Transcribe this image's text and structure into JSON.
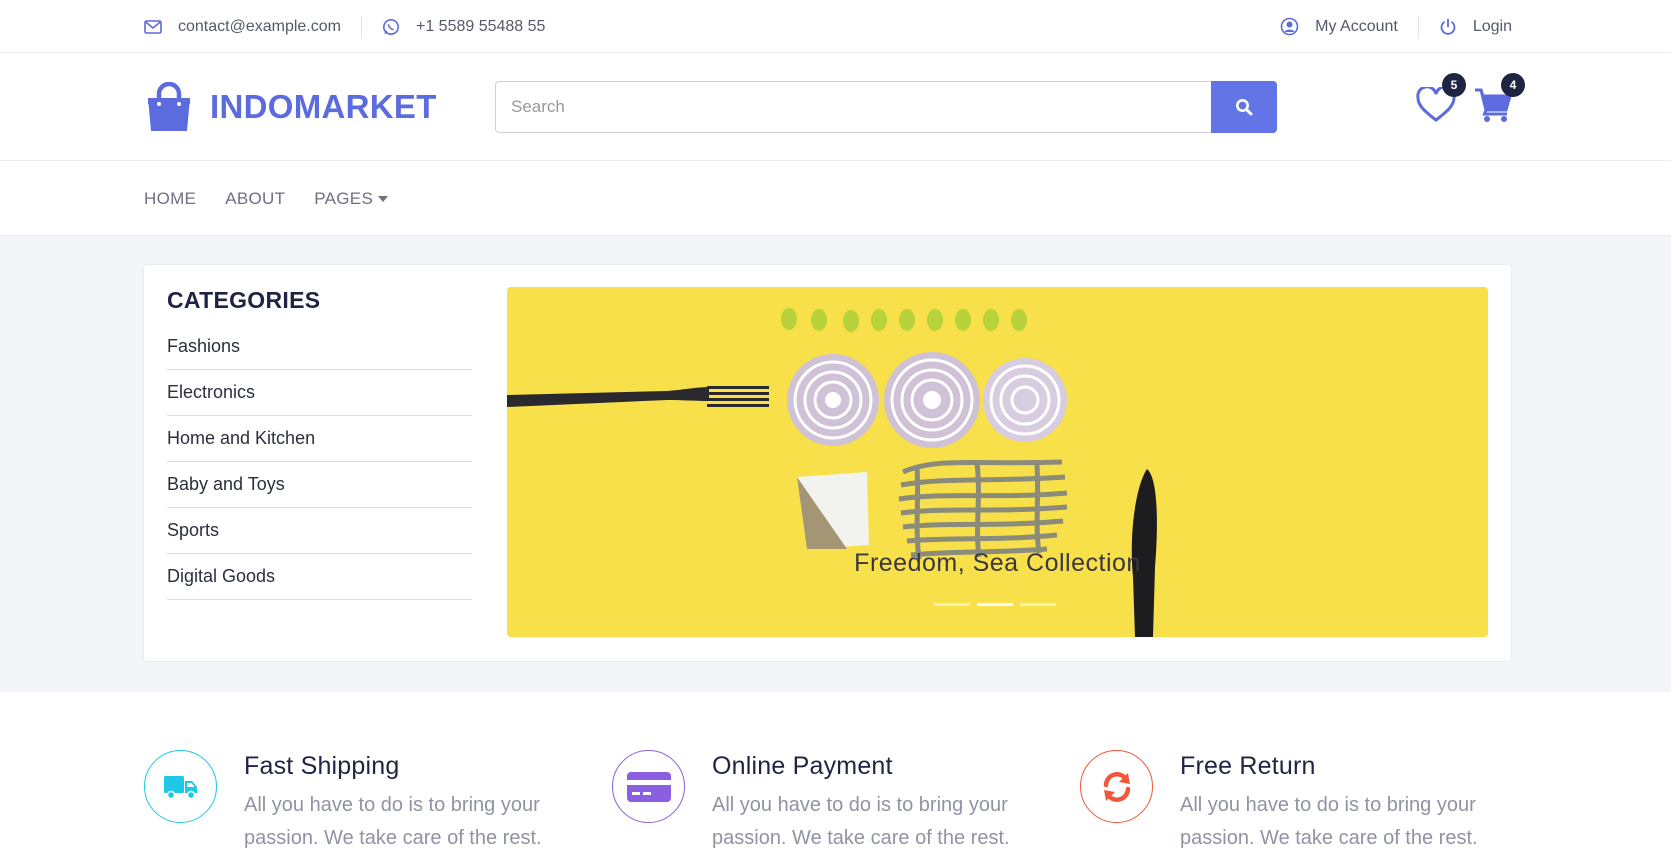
{
  "topbar": {
    "email": "contact@example.com",
    "phone": "+1 5589 55488 55",
    "account_label": "My Account",
    "login_label": "Login"
  },
  "header": {
    "brand": "INDOMARKET",
    "search_placeholder": "Search",
    "wishlist_count": "5",
    "cart_count": "4"
  },
  "nav": {
    "items": [
      "HOME",
      "ABOUT",
      "PAGES"
    ]
  },
  "categories": {
    "title": "CATEGORIES",
    "items": [
      "Fashions",
      "Electronics",
      "Home and Kitchen",
      "Baby and Toys",
      "Sports",
      "Digital Goods"
    ]
  },
  "slider": {
    "caption": "Freedom, Sea Collection",
    "slide_count": 3,
    "active_slide": 2
  },
  "features": [
    {
      "title": "Fast Shipping",
      "desc": "All you have to do is to bring your passion. We take care of the rest.",
      "icon": "truck-icon",
      "color": "#1ec9e6"
    },
    {
      "title": "Online Payment",
      "desc": "All you have to do is to bring your passion. We take care of the rest.",
      "icon": "credit-card-icon",
      "color": "#8a5fe0"
    },
    {
      "title": "Free Return",
      "desc": "All you have to do is to bring your passion. We take care of the rest.",
      "icon": "refresh-icon",
      "color": "#f2573a"
    }
  ],
  "colors": {
    "brand": "#5c6bdd",
    "search_button": "#6374e6",
    "badge": "#1f2442",
    "slider_background": "#f8e04a",
    "hero_background": "#f4f5f9"
  }
}
